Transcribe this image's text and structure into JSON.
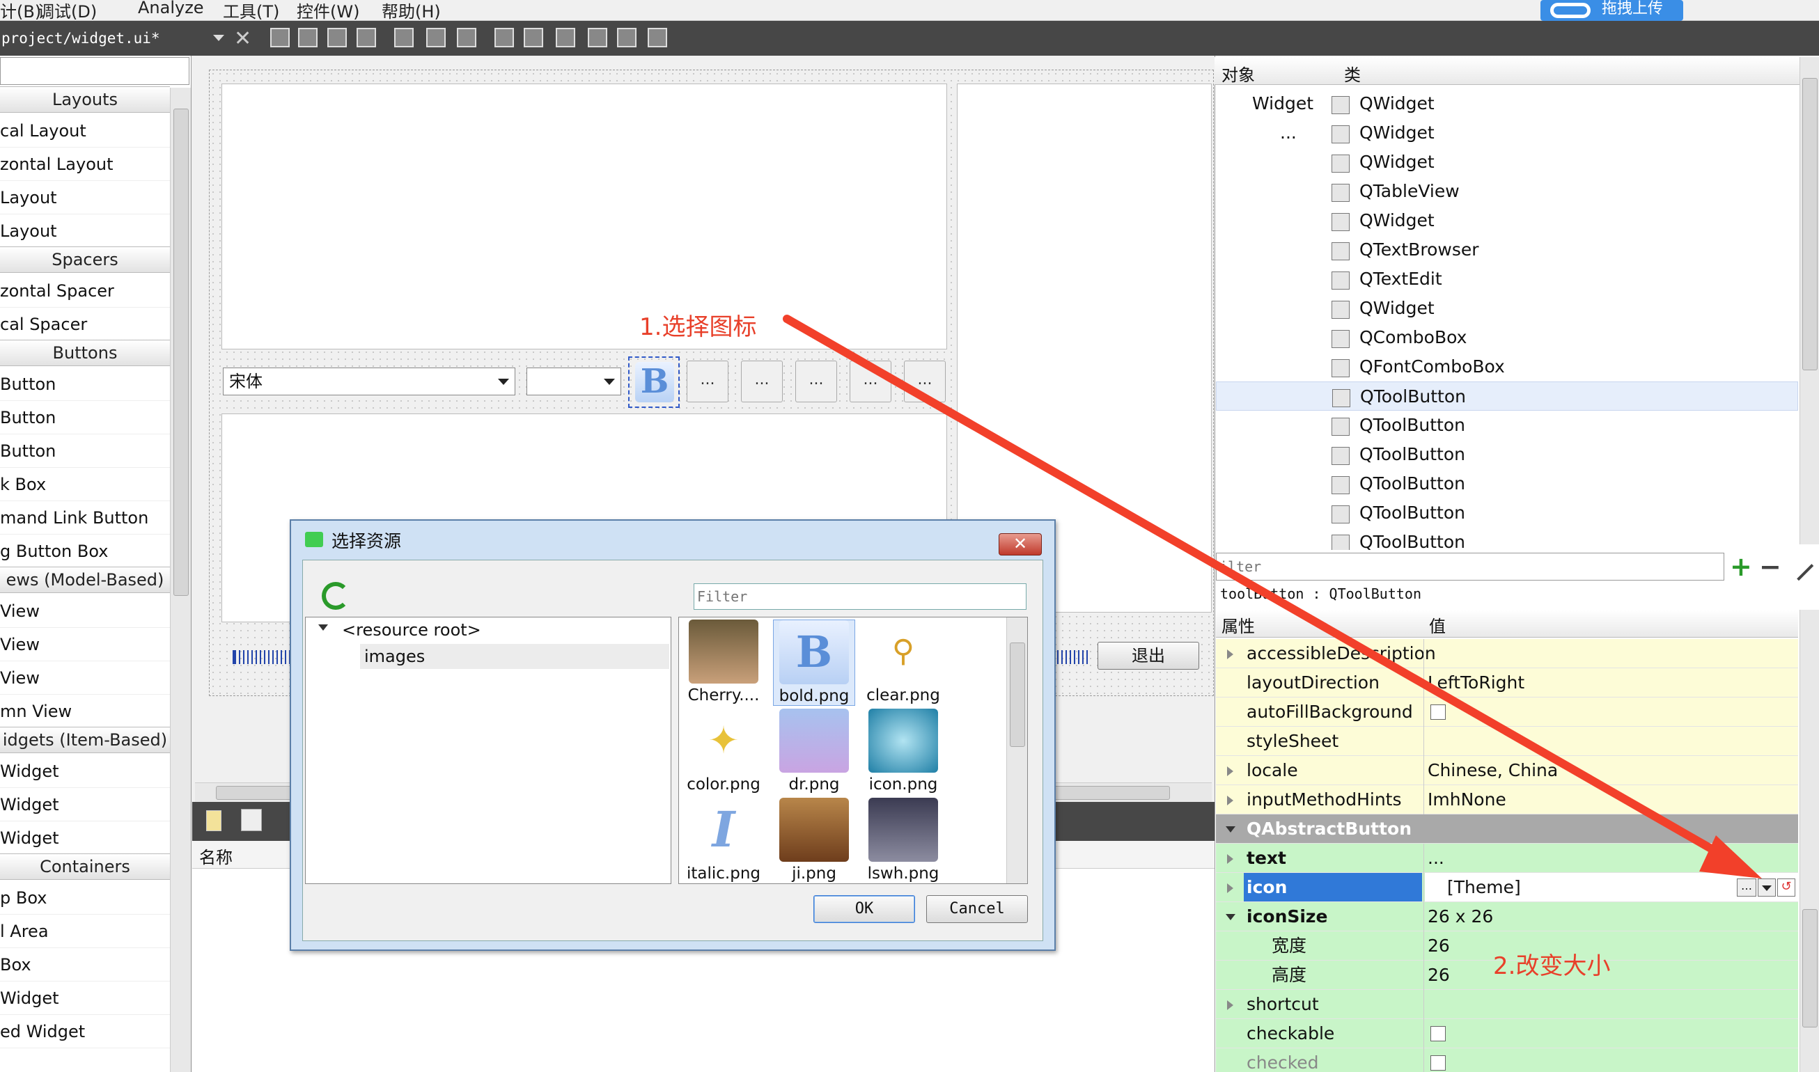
{
  "menu": {
    "items": [
      "计(B)",
      "调试(D)",
      "Analyze",
      "工具(T)",
      "控件(W)",
      "帮助(H)"
    ],
    "upload_label": "拖拽上传"
  },
  "toolbar": {
    "file": "project/widget.ui*",
    "close_glyph": "✕"
  },
  "widget_box": {
    "sections": [
      {
        "title": "Layouts",
        "items": [
          "cal Layout",
          "zontal Layout",
          "Layout",
          "Layout"
        ]
      },
      {
        "title": "Spacers",
        "items": [
          "zontal Spacer",
          "cal Spacer"
        ]
      },
      {
        "title": "Buttons",
        "items": [
          "Button",
          "Button",
          "Button",
          "k Box",
          "mand Link Button",
          "g Button Box"
        ]
      },
      {
        "title": "ews (Model-Based)",
        "items": [
          "View",
          "View",
          "View",
          "mn View"
        ]
      },
      {
        "title": "idgets (Item-Based)",
        "items": [
          "Widget",
          "Widget",
          "Widget"
        ]
      },
      {
        "title": "Containers",
        "items": [
          "p Box",
          "l Area",
          "Box",
          "Widget",
          "ed Widget"
        ]
      }
    ]
  },
  "form": {
    "font_combo": "宋体",
    "bold_glyph": "B",
    "dots": "...",
    "exit_button": "退出"
  },
  "annotations": {
    "step1": "1.选择图标",
    "step2": "2.改变大小"
  },
  "dialog": {
    "title": "选择资源",
    "filter_placeholder": "Filter",
    "tree_root": "<resource root>",
    "tree_child": "images",
    "thumbnails": [
      "Cherry....",
      "bold.png",
      "clear.png",
      "color.png",
      "dr.png",
      "icon.png",
      "italic.png",
      "ji.png",
      "lswh.png"
    ],
    "ok": "OK",
    "cancel": "Cancel"
  },
  "resource_panel": {
    "header": "名称"
  },
  "object_inspector": {
    "col_object": "对象",
    "col_class": "类",
    "rows": [
      {
        "object": "Widget",
        "class": "QWidget"
      },
      {
        "object": "...",
        "class": "QWidget"
      },
      {
        "object": "",
        "class": "QWidget"
      },
      {
        "object": "",
        "class": "QTableView"
      },
      {
        "object": "",
        "class": "QWidget"
      },
      {
        "object": "",
        "class": "QTextBrowser"
      },
      {
        "object": "",
        "class": "QTextEdit"
      },
      {
        "object": "",
        "class": "QWidget"
      },
      {
        "object": "",
        "class": "QComboBox"
      },
      {
        "object": "",
        "class": "QFontComboBox"
      },
      {
        "object": "",
        "class": "QToolButton"
      },
      {
        "object": "",
        "class": "QToolButton"
      },
      {
        "object": "",
        "class": "QToolButton"
      },
      {
        "object": "",
        "class": "QToolButton"
      },
      {
        "object": "",
        "class": "QToolButton"
      },
      {
        "object": "",
        "class": "QToolButton"
      }
    ]
  },
  "property_editor": {
    "filter_placeholder": "ilter",
    "context": "toolButton : QToolButton",
    "col_property": "属性",
    "col_value": "值",
    "rows": [
      {
        "key": "accessibleDescription",
        "value": ""
      },
      {
        "key": "layoutDirection",
        "value": "LeftToRight"
      },
      {
        "key": "autoFillBackground",
        "value": ""
      },
      {
        "key": "styleSheet",
        "value": ""
      },
      {
        "key": "locale",
        "value": "Chinese, China"
      },
      {
        "key": "inputMethodHints",
        "value": "ImhNone"
      },
      {
        "key": "QAbstractButton",
        "value": ""
      },
      {
        "key": "text",
        "value": "..."
      },
      {
        "key": "icon",
        "value": "[Theme]"
      },
      {
        "key": "iconSize",
        "value": "26 x 26"
      },
      {
        "key": "宽度",
        "value": "26"
      },
      {
        "key": "高度",
        "value": "26"
      },
      {
        "key": "shortcut",
        "value": ""
      },
      {
        "key": "checkable",
        "value": ""
      },
      {
        "key": "checked",
        "value": ""
      }
    ]
  },
  "colors": {
    "annotation_red": "#e8402a",
    "selection_blue": "#3079d8",
    "row_green": "#c8f5c8",
    "row_yellow": "#fdfcd7"
  }
}
